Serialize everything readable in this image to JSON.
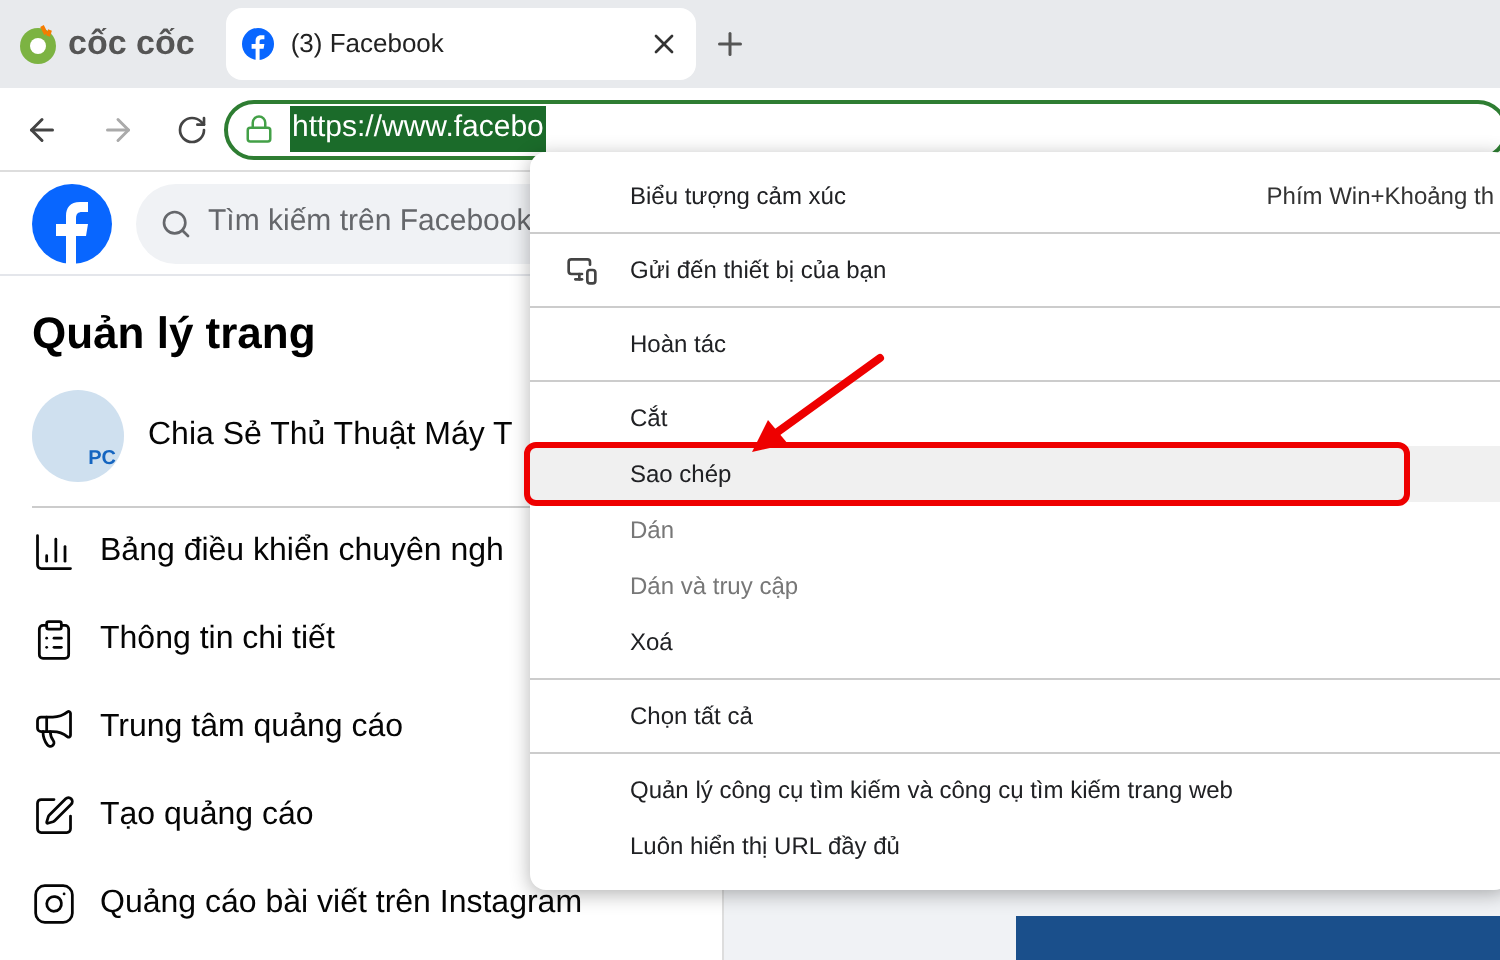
{
  "browser": {
    "brand": "cốc cốc",
    "tabs": [
      {
        "title": "(3) Facebook",
        "selected": true
      }
    ],
    "address": "https://www.facebo"
  },
  "facebook": {
    "search": {
      "placeholder": "Tìm kiếm trên Facebook"
    },
    "heading": "Quản lý trang",
    "page_name": "Chia Sẻ Thủ Thuật Máy T",
    "avatar_text": "PC",
    "menu": [
      {
        "label": "Bảng điều khiển chuyên ngh",
        "kind": "chart"
      },
      {
        "label": "Thông tin chi tiết",
        "kind": "info"
      },
      {
        "label": "Trung tâm quảng cáo",
        "kind": "megaphone"
      },
      {
        "label": "Tạo quảng cáo",
        "kind": "pencil"
      },
      {
        "label": "Quảng cáo bài viết trên Instagram",
        "kind": "instagram"
      }
    ]
  },
  "context_menu": {
    "groups": [
      [
        {
          "label": "Biểu tượng cảm xúc",
          "shortcut": "Phím Win+Khoảng th",
          "disabled": false,
          "selected": false
        }
      ],
      [
        {
          "label": "Gửi đến thiết bị của bạn",
          "kind": "devices",
          "disabled": false,
          "selected": false
        }
      ],
      [
        {
          "label": "Hoàn tác",
          "disabled": false,
          "selected": false
        }
      ],
      [
        {
          "label": "Cắt",
          "disabled": false,
          "selected": false
        },
        {
          "label": "Sao chép",
          "disabled": false,
          "selected": true
        },
        {
          "label": "Dán",
          "disabled": true,
          "selected": false
        },
        {
          "label": "Dán và truy cập",
          "disabled": true,
          "selected": false
        },
        {
          "label": "Xoá",
          "disabled": false,
          "selected": false
        }
      ],
      [
        {
          "label": "Chọn tất cả",
          "disabled": false,
          "selected": false
        }
      ],
      [
        {
          "label": "Quản lý công cụ tìm kiếm và công cụ tìm kiếm trang web",
          "disabled": false,
          "selected": false
        },
        {
          "label": "Luôn hiển thị URL đầy đủ",
          "disabled": false,
          "selected": false
        }
      ]
    ]
  }
}
